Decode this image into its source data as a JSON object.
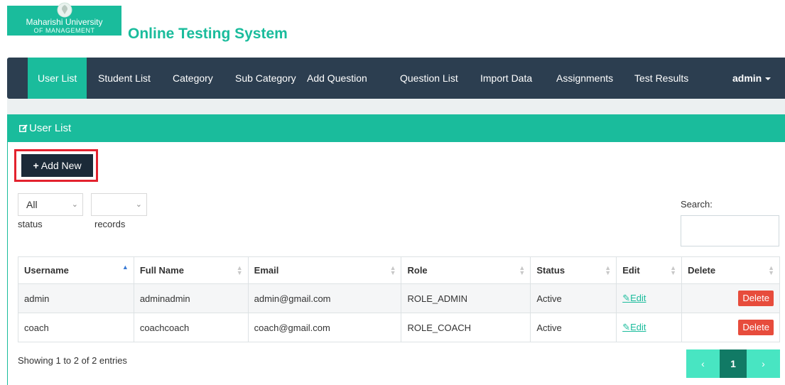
{
  "brand": {
    "line1": "Maharishi University",
    "line2": "OF MANAGEMENT",
    "logo_icon": "university-seal-icon"
  },
  "app_title": "Online Testing System",
  "nav": {
    "items": [
      {
        "label": "User List",
        "active": true
      },
      {
        "label": "Student List"
      },
      {
        "label": "Category"
      },
      {
        "label": "Sub Category"
      },
      {
        "label": "Add Question"
      },
      {
        "label": "Question List"
      },
      {
        "label": "Import Data"
      },
      {
        "label": "Assignments"
      },
      {
        "label": "Test Results"
      }
    ],
    "user": "admin"
  },
  "panel": {
    "title": "User List",
    "title_icon": "edit-icon",
    "add_button": "Add New",
    "add_icon": "plus-icon"
  },
  "filters": {
    "status_value": "All",
    "status_label": "status",
    "records_value": "",
    "records_label": "records",
    "search_label": "Search:",
    "search_value": ""
  },
  "table": {
    "columns": [
      "Username",
      "Full Name",
      "Email",
      "Role",
      "Status",
      "Edit",
      "Delete"
    ],
    "rows": [
      {
        "username": "admin",
        "fullname": "adminadmin",
        "email": "admin@gmail.com",
        "role": "ROLE_ADMIN",
        "status": "Active",
        "edit": "Edit",
        "delete": "Delete"
      },
      {
        "username": "coach",
        "fullname": "coachcoach",
        "email": "coach@gmail.com",
        "role": "ROLE_COACH",
        "status": "Active",
        "edit": "Edit",
        "delete": "Delete"
      }
    ]
  },
  "info": "Showing 1 to 2 of 2 entries",
  "pagination": {
    "prev": "‹",
    "current": "1",
    "next": "›"
  },
  "colors": {
    "accent": "#1abc9c",
    "navbar": "#2c3e50",
    "danger": "#e74c3c",
    "highlight_border": "#e3222e"
  }
}
